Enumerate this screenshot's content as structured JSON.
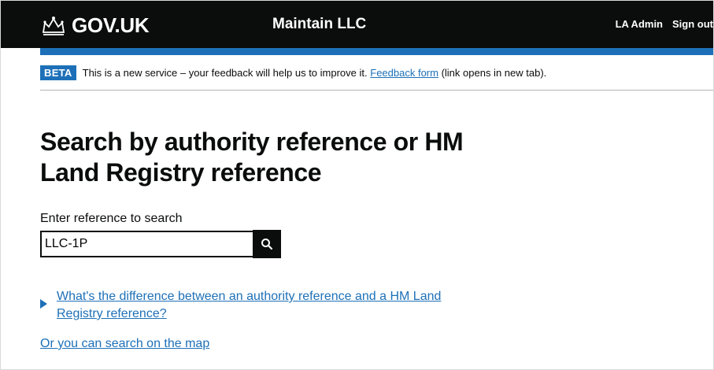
{
  "header": {
    "logo_text": "GOV.UK",
    "service_name": "Maintain LLC",
    "nav": {
      "user": "LA Admin",
      "sign_out": "Sign out"
    }
  },
  "phase_banner": {
    "tag": "BETA",
    "text_before": "This is a new service – your feedback will help us to improve it.",
    "link": "Feedback form",
    "text_after": "(link opens in new tab)."
  },
  "main": {
    "title": "Search by authority reference or HM Land Registry reference",
    "search": {
      "label": "Enter reference to search",
      "value": "LLC-1P",
      "button_icon": "search-icon"
    },
    "details_summary": "What's the difference between an authority reference and a HM Land Registry reference?",
    "map_link": "Or you can search on the map"
  },
  "colors": {
    "header_bg": "#0b0c0c",
    "accent": "#1d70b8",
    "link": "#1d70b8"
  }
}
